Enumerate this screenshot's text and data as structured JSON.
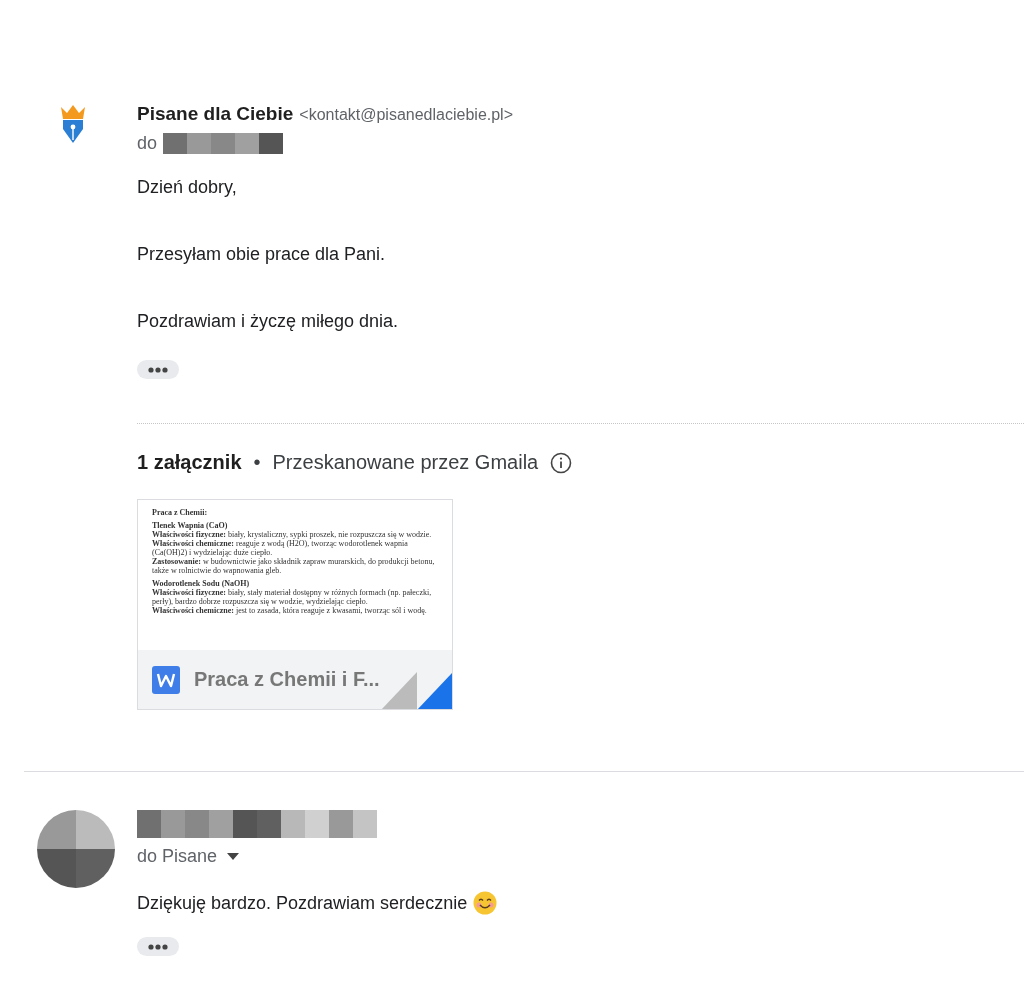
{
  "sender": {
    "name": "Pisane dla Ciebie",
    "email": "<kontakt@pisanedlaciebie.pl>",
    "to_label": "do"
  },
  "body": [
    "Dzień dobry,",
    "Przesyłam obie prace dla Pani.",
    "Pozdrawiam i życzę miłego dnia."
  ],
  "attachments_header": {
    "count": "1 załącznik",
    "separator": "•",
    "scan_note": "Przeskanowane przez Gmaila"
  },
  "attachments": [
    {
      "filename": "Praca z Chemii i F...",
      "preview": [
        {
          "kind": "title",
          "text": "Praca z Chemii:"
        },
        {
          "kind": "heading",
          "text": "Tlenek Wapnia (CaO)"
        },
        {
          "kind": "field",
          "text": "**Właściwości fizyczne:** biały, krystaliczny, sypki proszek, nie rozpuszcza się w wodzie."
        },
        {
          "kind": "field",
          "text": "**Właściwości chemiczne:** reaguje z wodą (H2O), tworząc wodorotlenek wapnia (Ca(OH)2) i wydzielając duże ciepło."
        },
        {
          "kind": "field",
          "text": "**Zastosowanie:** w budownictwie jako składnik zapraw murarskich, do produkcji betonu, także w rolnictwie do wapnowania gleb."
        },
        {
          "kind": "heading",
          "text": "Wodorotlenek Sodu (NaOH)"
        },
        {
          "kind": "field",
          "text": "**Właściwości fizyczne:** biały, stały materiał dostępny w różnych formach (np. pałeczki, perły), bardzo dobrze rozpuszcza się w wodzie, wydzielając ciepło."
        },
        {
          "kind": "field",
          "text": "**Właściwości chemiczne:** jest to zasada, która reaguje z kwasami, tworząc sól i wodę."
        }
      ]
    }
  ],
  "reply": {
    "to_label": "do Pisane",
    "body": "Dziękuję bardzo. Pozdrawiam serdecznie"
  }
}
